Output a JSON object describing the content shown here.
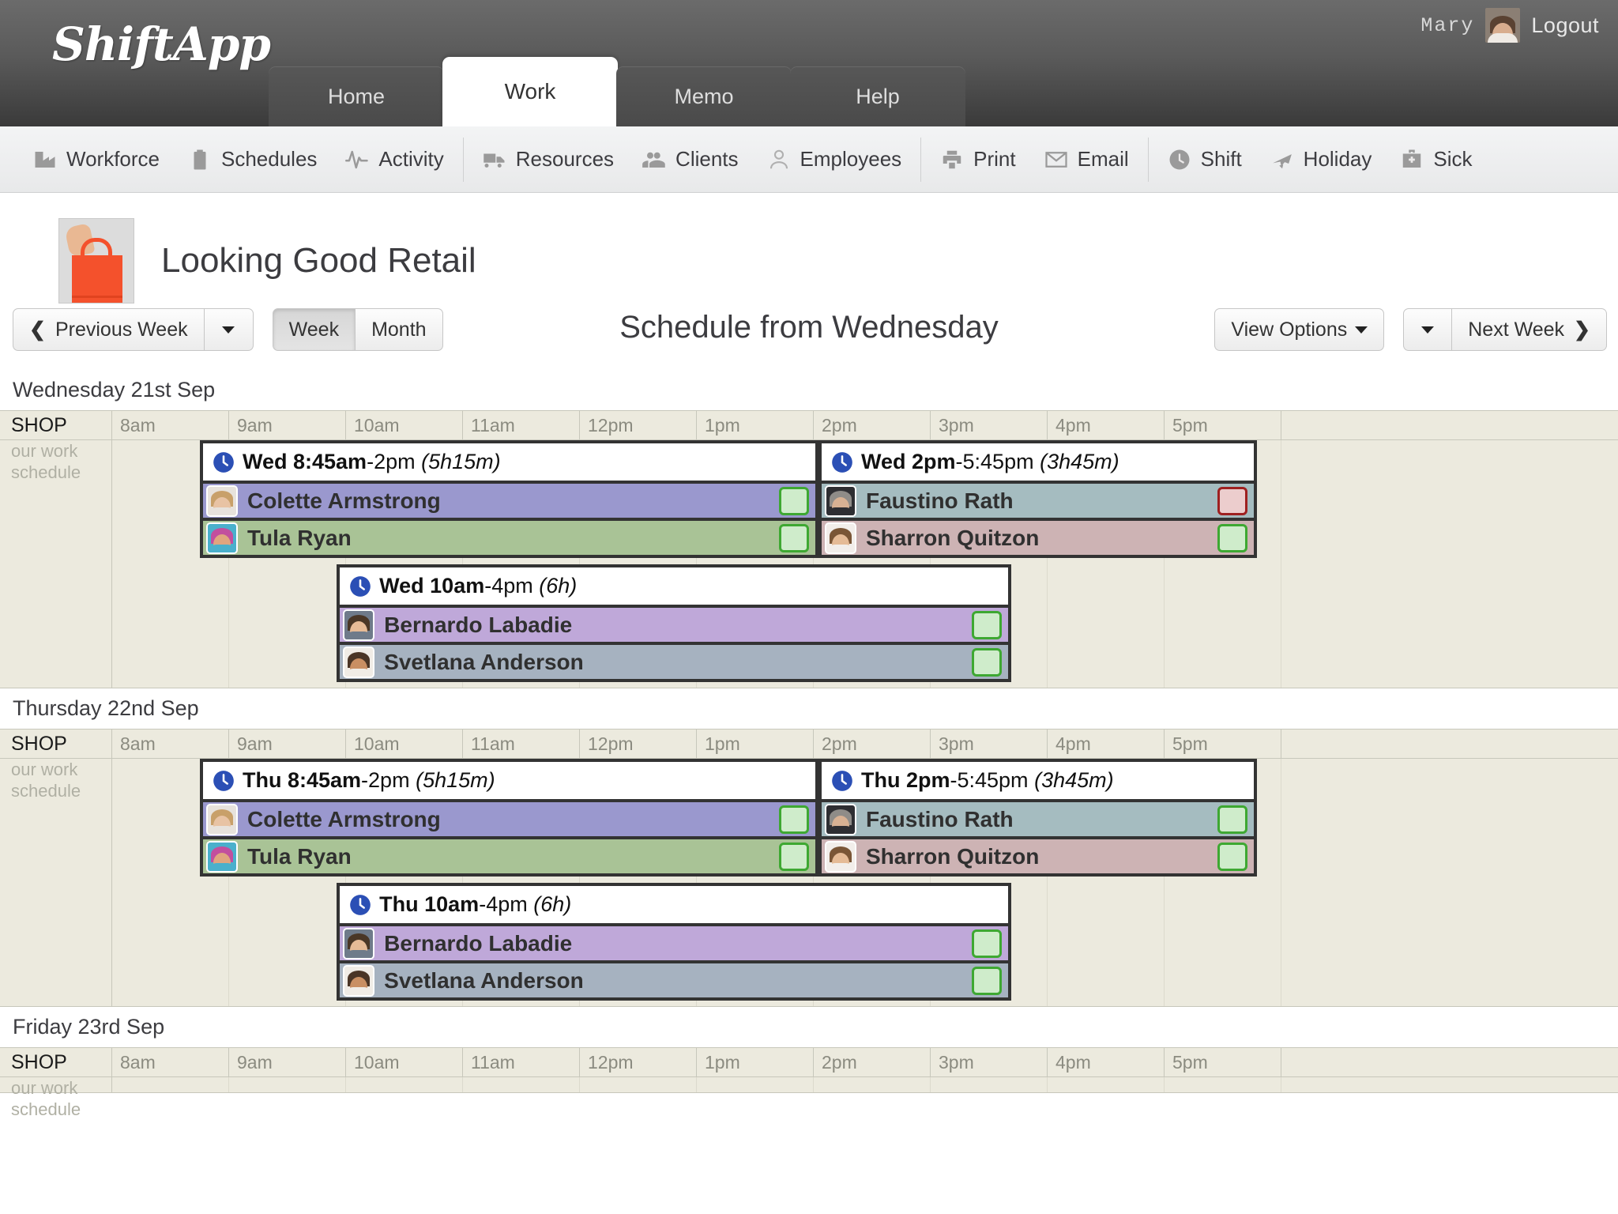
{
  "app": {
    "logo": "ShiftApp",
    "user_name": "Mary",
    "logout_label": "Logout"
  },
  "tabs": [
    {
      "label": "Home",
      "active": false
    },
    {
      "label": "Work",
      "active": true
    },
    {
      "label": "Memo",
      "active": false
    },
    {
      "label": "Help",
      "active": false
    }
  ],
  "toolbar": [
    {
      "label": "Workforce",
      "icon": "factory-icon"
    },
    {
      "label": "Schedules",
      "icon": "clipboard-icon"
    },
    {
      "label": "Activity",
      "icon": "pulse-icon"
    },
    {
      "sep": true
    },
    {
      "label": "Resources",
      "icon": "truck-icon"
    },
    {
      "label": "Clients",
      "icon": "users-icon"
    },
    {
      "label": "Employees",
      "icon": "person-outline-icon"
    },
    {
      "sep": true
    },
    {
      "label": "Print",
      "icon": "printer-icon"
    },
    {
      "label": "Email",
      "icon": "envelope-icon"
    },
    {
      "sep": true
    },
    {
      "label": "Shift",
      "icon": "clock-icon"
    },
    {
      "label": "Holiday",
      "icon": "airplane-icon"
    },
    {
      "label": "Sick",
      "icon": "medical-bag-icon"
    }
  ],
  "page": {
    "title": "Looking Good Retail",
    "logo_alt": "red shopping bag held by hand"
  },
  "nav": {
    "previous_week": "Previous Week",
    "week": "Week",
    "month": "Month",
    "view_options": "View Options",
    "next_week": "Next Week",
    "schedule_title": "Schedule from Wednesday",
    "active_range": "Week"
  },
  "grid": {
    "shop_label": "SHOP",
    "shop_sub_1": "our work",
    "shop_sub_2": "schedule",
    "hours": [
      "8am",
      "9am",
      "10am",
      "11am",
      "12pm",
      "1pm",
      "2pm",
      "3pm",
      "4pm",
      "5pm"
    ]
  },
  "days": [
    {
      "label": "Wednesday 21st Sep",
      "shifts": [
        {
          "day_prefix": "Wed",
          "start": "8:45am",
          "end": "-2pm",
          "duration": "(5h15m)",
          "employees": [
            {
              "name": "Colette Armstrong",
              "color": "#9a98ce",
              "status": "green",
              "skin": "#e8c3a4",
              "hair": "#c8a06a",
              "cloth": "#e7e2dc"
            },
            {
              "name": "Tula Ryan",
              "color": "#a9c396",
              "status": "green",
              "skin": "#e0a57f",
              "hair": "#c24f9e",
              "cloth": "#4ab0cc"
            }
          ]
        },
        {
          "day_prefix": "Wed",
          "start": "2pm",
          "end": "-5:45pm",
          "duration": "(3h45m)",
          "employees": [
            {
              "name": "Faustino Rath",
              "color": "#a5bcc0",
              "status": "red",
              "skin": "#d8b193",
              "hair": "#8f8c88",
              "cloth": "#2e2e32"
            },
            {
              "name": "Sharron Quitzon",
              "color": "#cdb3b4",
              "status": "green",
              "skin": "#e5bb96",
              "hair": "#7a5636",
              "cloth": "#f2eeea"
            }
          ]
        },
        {
          "day_prefix": "Wed",
          "start": "10am",
          "end": "-4pm",
          "duration": "(6h)",
          "employees": [
            {
              "name": "Bernardo Labadie",
              "color": "#bfa8d9",
              "status": "green",
              "skin": "#e6bb96",
              "hair": "#4a3726",
              "cloth": "#6f7b8a"
            },
            {
              "name": "Svetlana Anderson",
              "color": "#a6b2c0",
              "status": "green",
              "skin": "#c98f63",
              "hair": "#4a3526",
              "cloth": "#f0ece6"
            }
          ]
        }
      ]
    },
    {
      "label": "Thursday 22nd Sep",
      "shifts": [
        {
          "day_prefix": "Thu",
          "start": "8:45am",
          "end": "-2pm",
          "duration": "(5h15m)",
          "employees": [
            {
              "name": "Colette Armstrong",
              "color": "#9a98ce",
              "status": "green",
              "skin": "#e8c3a4",
              "hair": "#c8a06a",
              "cloth": "#e7e2dc"
            },
            {
              "name": "Tula Ryan",
              "color": "#a9c396",
              "status": "green",
              "skin": "#e0a57f",
              "hair": "#c24f9e",
              "cloth": "#4ab0cc"
            }
          ]
        },
        {
          "day_prefix": "Thu",
          "start": "2pm",
          "end": "-5:45pm",
          "duration": "(3h45m)",
          "employees": [
            {
              "name": "Faustino Rath",
              "color": "#a5bcc0",
              "status": "green",
              "skin": "#d8b193",
              "hair": "#8f8c88",
              "cloth": "#2e2e32"
            },
            {
              "name": "Sharron Quitzon",
              "color": "#cdb3b4",
              "status": "green",
              "skin": "#e5bb96",
              "hair": "#7a5636",
              "cloth": "#f2eeea"
            }
          ]
        },
        {
          "day_prefix": "Thu",
          "start": "10am",
          "end": "-4pm",
          "duration": "(6h)",
          "employees": [
            {
              "name": "Bernardo Labadie",
              "color": "#bfa8d9",
              "status": "green",
              "skin": "#e6bb96",
              "hair": "#4a3726",
              "cloth": "#6f7b8a"
            },
            {
              "name": "Svetlana Anderson",
              "color": "#a6b2c0",
              "status": "green",
              "skin": "#c98f63",
              "hair": "#4a3526",
              "cloth": "#f0ece6"
            }
          ]
        }
      ]
    },
    {
      "label": "Friday 23rd Sep",
      "shifts": []
    }
  ]
}
